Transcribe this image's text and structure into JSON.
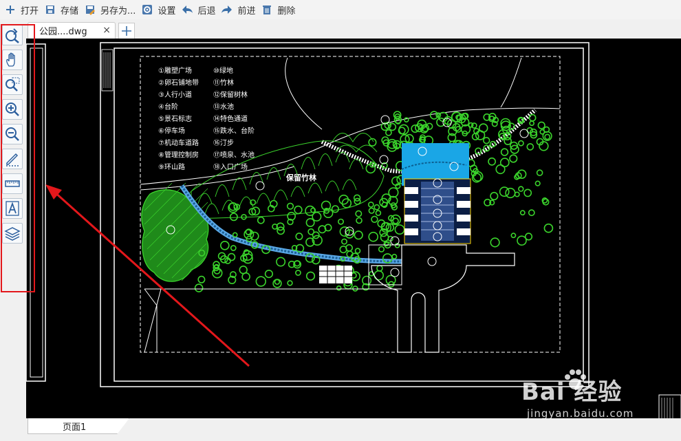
{
  "toolbar": {
    "open": "打开",
    "save": "存储",
    "save_as": "另存为...",
    "settings": "设置",
    "back": "后退",
    "forward": "前进",
    "delete": "删除"
  },
  "left_tools": [
    "back-arrow-icon",
    "pan-hand-icon",
    "zoom-window-icon",
    "zoom-in-icon",
    "zoom-out-icon",
    "pencil-icon",
    "measure-ruler-icon",
    "text-tool-icon",
    "layers-icon"
  ],
  "tab": {
    "label": "公园....dwg",
    "close": "×",
    "add": "+"
  },
  "legend_left": [
    "①雕塑广场",
    "②卵石铺地带",
    "③人行小道",
    "④台阶",
    "⑤景石标志",
    "⑥停车场",
    "⑦机动车道路",
    "⑧管理控制房",
    "⑨环山路"
  ],
  "legend_right": [
    "⑩绿地",
    "⑪竹林",
    "⑫保留树林",
    "⑬水池",
    "⑭特色通道",
    "⑮跌水、台阶",
    "⑯汀步",
    "⑰喷泉、水池",
    "⑱入口广场"
  ],
  "drawing_label": "保留竹林",
  "page_tab": "页面1",
  "watermark": {
    "main": "Bai  经验",
    "sub": "jingyan.baidu.com"
  },
  "colors": {
    "canvas": "#000000",
    "tree_green": "#3bd42c",
    "water_blue": "#1aa6e6",
    "highlight_red": "#e3171b"
  }
}
